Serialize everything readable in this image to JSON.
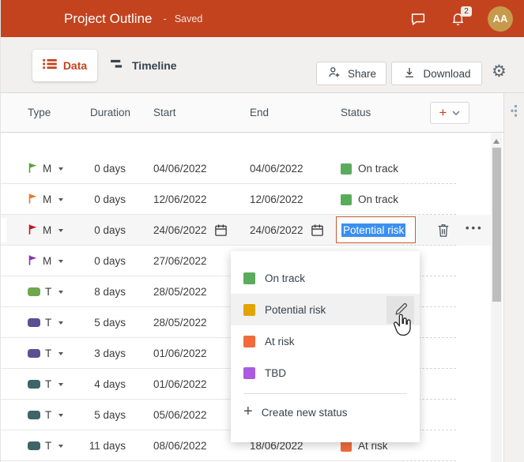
{
  "topbar": {
    "title": "Project Outline",
    "dash": "-",
    "saved_label": "Saved",
    "notification_count": "2",
    "avatar_initials": "AA"
  },
  "toolbar": {
    "data_tab": "Data",
    "timeline_tab": "Timeline",
    "share_label": "Share",
    "download_label": "Download"
  },
  "grid": {
    "columns": [
      "Type",
      "Duration",
      "Start",
      "End",
      "Status"
    ],
    "rows": [
      {
        "kind": "milestone",
        "type_label": "M",
        "type_color": "#55A33A",
        "duration": "0 days",
        "start": "04/06/2022",
        "end": "04/06/2022",
        "status": "On track",
        "status_color": "#5BAB5C",
        "selected": false
      },
      {
        "kind": "milestone",
        "type_label": "M",
        "type_color": "#E8772E",
        "duration": "0 days",
        "start": "12/06/2022",
        "end": "12/06/2022",
        "status": "On track",
        "status_color": "#5BAB5C",
        "selected": false
      },
      {
        "kind": "milestone",
        "type_label": "M",
        "type_color": "#C0161F",
        "duration": "0 days",
        "start": "24/06/2022",
        "end": "24/06/2022",
        "status": "",
        "status_color": "",
        "selected": true,
        "editing_status": "Potential risk",
        "show_calendars": true
      },
      {
        "kind": "milestone",
        "type_label": "M",
        "type_color": "#8632AE",
        "duration": "0 days",
        "start": "27/06/2022",
        "end": "",
        "status": "",
        "status_color": "",
        "selected": false
      },
      {
        "kind": "task",
        "type_label": "T",
        "type_color": "#6FA84C",
        "duration": "8 days",
        "start": "28/05/2022",
        "end": "",
        "status": "",
        "status_color": "",
        "selected": false
      },
      {
        "kind": "task",
        "type_label": "T",
        "type_color": "#585293",
        "duration": "5 days",
        "start": "28/05/2022",
        "end": "",
        "status": "",
        "status_color": "",
        "selected": false
      },
      {
        "kind": "task",
        "type_label": "T",
        "type_color": "#585293",
        "duration": "3 days",
        "start": "01/06/2022",
        "end": "",
        "status": "",
        "status_color": "",
        "selected": false
      },
      {
        "kind": "task",
        "type_label": "T",
        "type_color": "#3E6468",
        "duration": "4 days",
        "start": "01/06/2022",
        "end": "",
        "status": "",
        "status_color": "",
        "selected": false
      },
      {
        "kind": "task",
        "type_label": "T",
        "type_color": "#3E6468",
        "duration": "5 days",
        "start": "05/06/2022",
        "end": "",
        "status": "",
        "status_color": "",
        "selected": false
      },
      {
        "kind": "task",
        "type_label": "T",
        "type_color": "#3E6468",
        "duration": "11 days",
        "start": "08/06/2022",
        "end": "18/06/2022",
        "status": "At risk",
        "status_color": "#F26B3D",
        "selected": false
      }
    ]
  },
  "status_dropdown": {
    "options": [
      {
        "label": "On track",
        "color": "#5BAB5C",
        "highlighted": false
      },
      {
        "label": "Potential risk",
        "color": "#E2A400",
        "highlighted": true
      },
      {
        "label": "At risk",
        "color": "#F26B3D",
        "highlighted": false
      },
      {
        "label": "TBD",
        "color": "#AA5BE0",
        "highlighted": false
      }
    ],
    "create_label": "Create new status"
  },
  "icons": {
    "topbar": [
      "chat-bubble-icon",
      "bell-icon",
      "avatar"
    ],
    "toolbar": [
      "list-icon",
      "timeline-icon",
      "add-person-icon",
      "download-icon",
      "gear-icon"
    ],
    "row": [
      "flag-icon",
      "task-bar-icon",
      "chevron-down-icon",
      "calendar-icon",
      "trash-icon",
      "ellipsis-icon"
    ],
    "dropdown": [
      "pencil-icon",
      "plus-icon"
    ],
    "misc": [
      "collapse-handle-icon",
      "scroll-up-arrow",
      "hand-cursor"
    ]
  },
  "colors": {
    "topbar_bg": "#C3431F",
    "accent": "#C3431F",
    "selection_blue": "#3A8FF0",
    "avatar_bg": "#C79A4B",
    "toolbar_bg": "#F1F0EF",
    "grid_header_bg": "#FAFAFA",
    "selected_row_bg": "#F6F6F6"
  }
}
